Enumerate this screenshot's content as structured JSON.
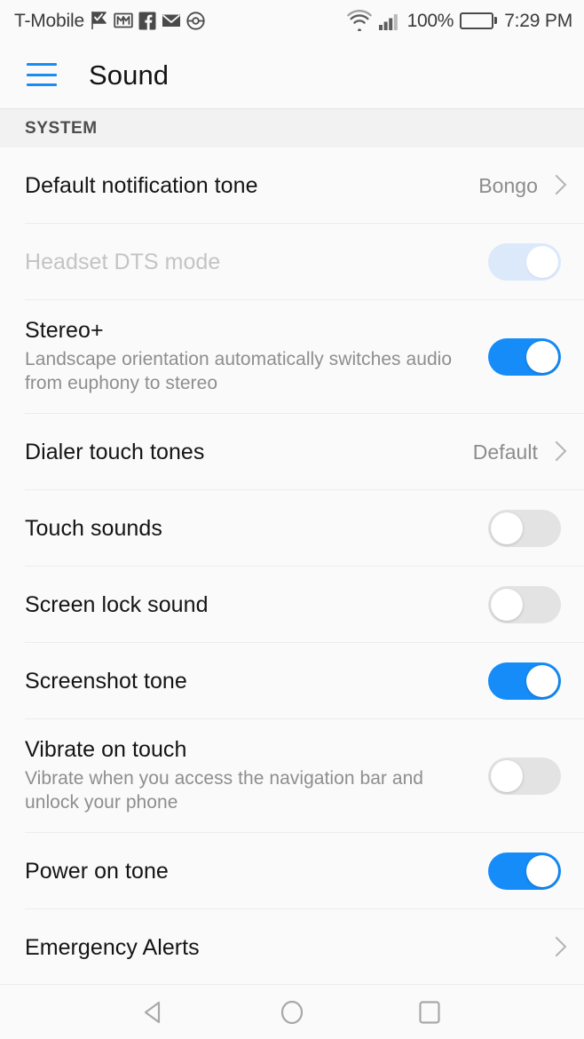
{
  "status_bar": {
    "carrier": "T-Mobile",
    "notification_icons": [
      "tasks-flag-icon",
      "gmail-icon",
      "facebook-icon",
      "email-envelope-icon",
      "pokeball-icon"
    ],
    "wifi_icon": "wifi-icon",
    "signal_icon": "cellular-signal-icon",
    "battery_percent": "100%",
    "battery_icon": "battery-full-icon",
    "time": "7:29 PM"
  },
  "app_bar": {
    "menu_icon": "hamburger-menu-icon",
    "title": "Sound",
    "accent_color": "#1a8cf0"
  },
  "section": {
    "header": "SYSTEM"
  },
  "colors": {
    "toggle_on": "#158cf7",
    "toggle_on_disabled": "#dbe9fb",
    "toggle_off": "#e3e3e3",
    "background": "#fafafa",
    "section_band": "#f2f2f2"
  },
  "rows": [
    {
      "name": "default-notification-tone",
      "title": "Default notification tone",
      "subtitle": "",
      "control": "value-chevron",
      "value": "Bongo",
      "disabled": false
    },
    {
      "name": "headset-dts-mode",
      "title": "Headset DTS mode",
      "subtitle": "",
      "control": "toggle",
      "toggle_state": "on",
      "disabled": true
    },
    {
      "name": "stereo-plus",
      "title": "Stereo+",
      "subtitle": "Landscape orientation automatically switches audio from euphony to stereo",
      "control": "toggle",
      "toggle_state": "on",
      "disabled": false
    },
    {
      "name": "dialer-touch-tones",
      "title": "Dialer touch tones",
      "subtitle": "",
      "control": "value-chevron",
      "value": "Default",
      "disabled": false
    },
    {
      "name": "touch-sounds",
      "title": "Touch sounds",
      "subtitle": "",
      "control": "toggle",
      "toggle_state": "off",
      "disabled": false
    },
    {
      "name": "screen-lock-sound",
      "title": "Screen lock sound",
      "subtitle": "",
      "control": "toggle",
      "toggle_state": "off",
      "disabled": false
    },
    {
      "name": "screenshot-tone",
      "title": "Screenshot tone",
      "subtitle": "",
      "control": "toggle",
      "toggle_state": "on",
      "disabled": false
    },
    {
      "name": "vibrate-on-touch",
      "title": "Vibrate on touch",
      "subtitle": "Vibrate when you access the navigation bar and unlock your phone",
      "control": "toggle",
      "toggle_state": "off",
      "disabled": false
    },
    {
      "name": "power-on-tone",
      "title": "Power on tone",
      "subtitle": "",
      "control": "toggle",
      "toggle_state": "on",
      "disabled": false
    },
    {
      "name": "emergency-alerts",
      "title": "Emergency Alerts",
      "subtitle": "",
      "control": "chevron",
      "value": "",
      "disabled": false
    }
  ],
  "nav_bar": {
    "back": "back-triangle-icon",
    "home": "home-circle-icon",
    "recents": "recents-square-icon"
  }
}
